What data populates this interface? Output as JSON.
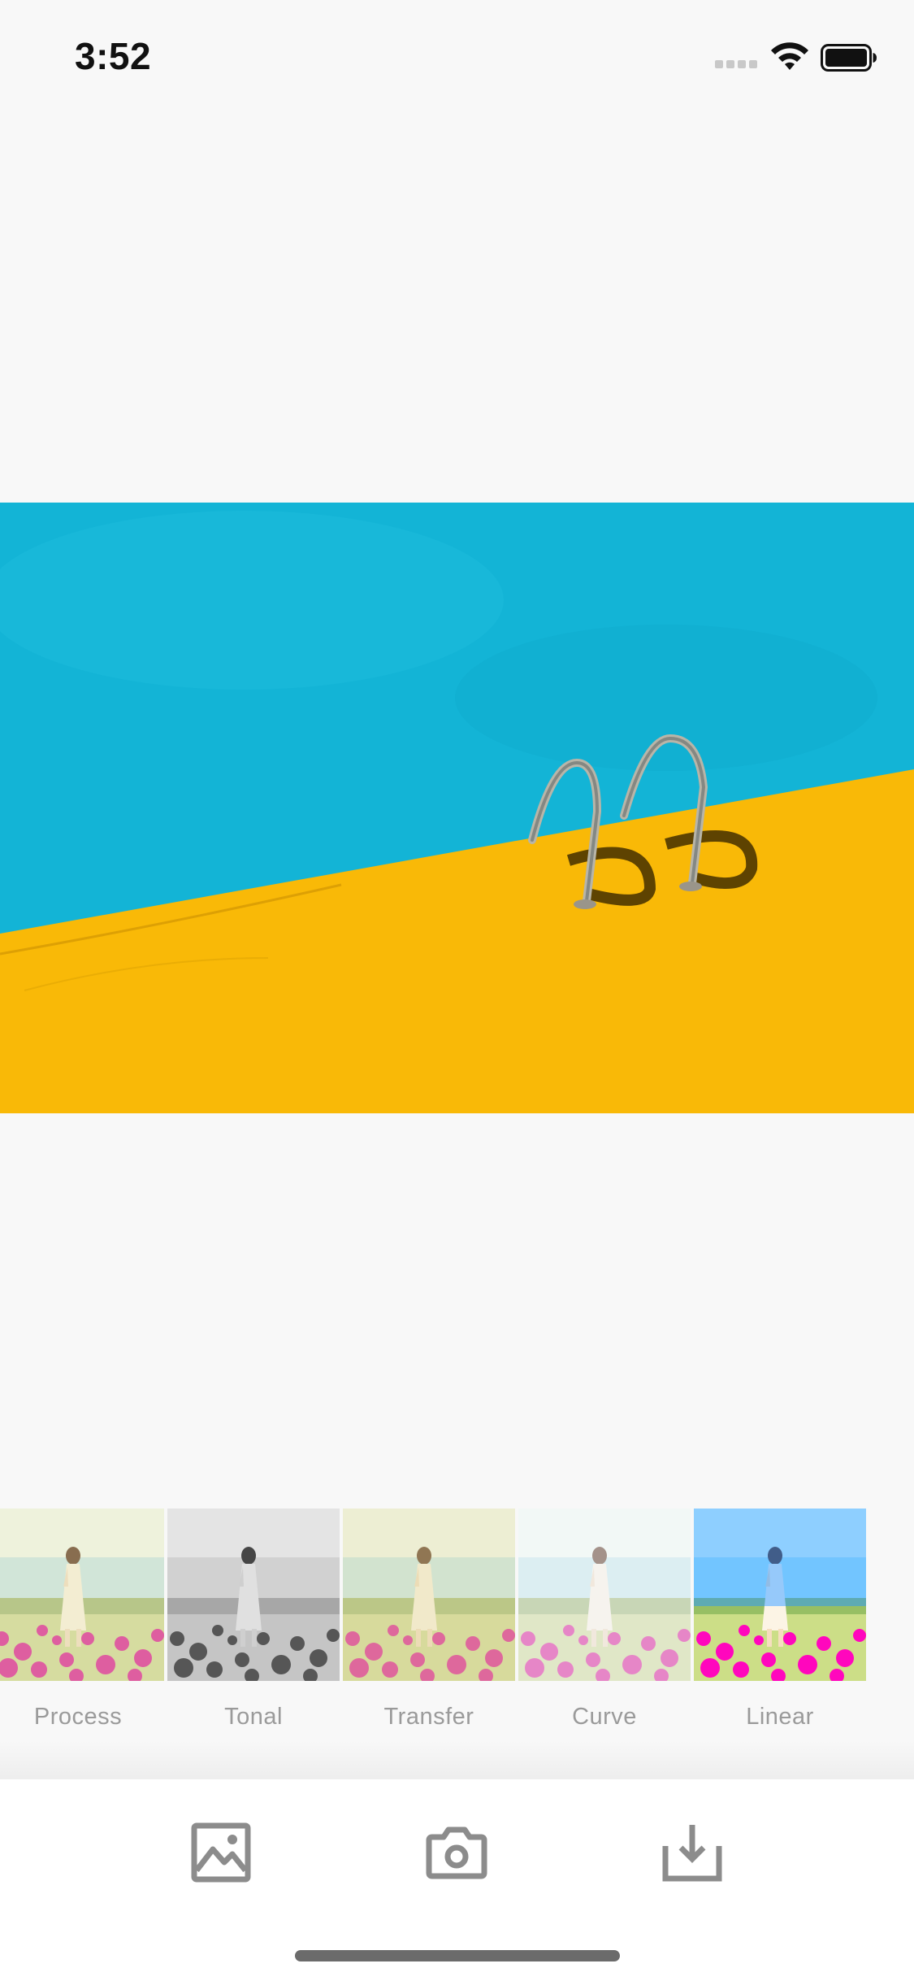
{
  "status_bar": {
    "time": "3:52"
  },
  "colors": {
    "pool_water": "#13b4d6",
    "pool_deck": "#f9b907",
    "filter_label": "#9a9a9a",
    "toolbar_icon": "#8c8c8c",
    "home_indicator": "#6b6b6b"
  },
  "main_photo": {
    "icon": "pool-ladder-photo"
  },
  "filters": [
    {
      "label": "Process"
    },
    {
      "label": "Tonal"
    },
    {
      "label": "Transfer"
    },
    {
      "label": "Curve"
    },
    {
      "label": "Linear"
    }
  ],
  "toolbar": {
    "items": [
      {
        "icon": "gallery-icon"
      },
      {
        "icon": "camera-icon"
      },
      {
        "icon": "download-icon"
      }
    ]
  }
}
